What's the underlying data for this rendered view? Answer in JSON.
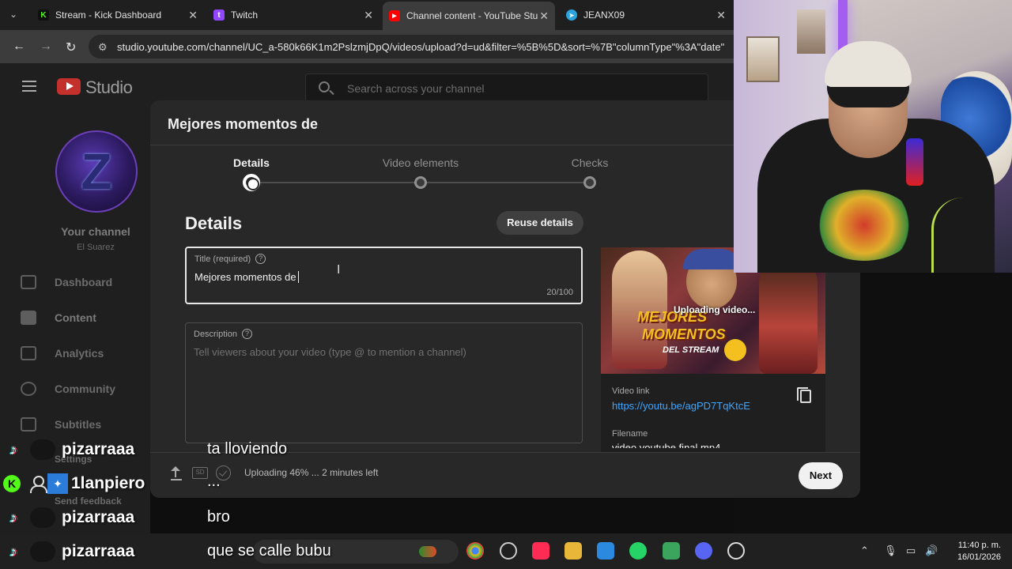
{
  "browser": {
    "tabs": [
      {
        "title": "Stream - Kick Dashboard",
        "favicon": "K"
      },
      {
        "title": "Twitch",
        "favicon": "twitch-icon"
      },
      {
        "title": "Channel content - YouTube Stu",
        "favicon": "youtube-icon"
      },
      {
        "title": "JEANX09",
        "favicon": "telegram-icon"
      }
    ],
    "url": "studio.youtube.com/channel/UC_a-580k66K1m2PslzmjDpQ/videos/upload?d=ud&filter=%5B%5D&sort=%7B\"columnType\"%3A\"date\""
  },
  "studio": {
    "logo_text": "Studio",
    "search_placeholder": "Search across your channel",
    "channel_label": "Your channel",
    "channel_name": "El Suarez",
    "nav": [
      {
        "label": "Dashboard"
      },
      {
        "label": "Content"
      },
      {
        "label": "Analytics"
      },
      {
        "label": "Community"
      },
      {
        "label": "Subtitles"
      }
    ]
  },
  "dialog": {
    "title": "Mejores momentos de",
    "steps": [
      {
        "label": "Details",
        "active": true
      },
      {
        "label": "Video elements",
        "active": false
      },
      {
        "label": "Checks",
        "active": false
      }
    ],
    "section_heading": "Details",
    "reuse_button": "Reuse details",
    "title_field": {
      "label": "Title (required)",
      "value": "Mejores momentos de",
      "counter": "20/100"
    },
    "description_field": {
      "label": "Description",
      "placeholder": "Tell viewers about your video (type @ to mention a channel)"
    },
    "preview": {
      "thumb_line1": "MEJORES",
      "thumb_line2": "MOMENTOS",
      "thumb_line3": "DEL STREAM",
      "overlay_status": "Uploading video...",
      "video_link_label": "Video link",
      "video_link": "https://youtu.be/agPD7TqKtcE",
      "filename_label": "Filename",
      "filename": "video youtube final mp4"
    },
    "footer": {
      "status": "Uploading 46% ... 2 minutes left",
      "progress_percent": 46,
      "next_button": "Next",
      "sd_badge": "SD"
    }
  },
  "chat": [
    {
      "platform": "tiktok",
      "user": "pizarraaa",
      "message": "ta lloviendo"
    },
    {
      "platform": "kick",
      "user": "1lanpiero",
      "message": "..."
    },
    {
      "platform": "tiktok",
      "user": "pizarraaa",
      "message": "bro"
    },
    {
      "platform": "tiktok",
      "user": "pizarraaa",
      "message": "que se calle bubu"
    }
  ],
  "hidden_nav": {
    "settings": "Settings",
    "feedback": "Send feedback"
  },
  "taskbar": {
    "time": "11:40 p. m.",
    "date": "16/01/2026"
  },
  "colors": {
    "youtube_red": "#c4302b",
    "link_blue": "#3ea6ff",
    "kick_green": "#53fc18",
    "neon_purple": "#a35ef0"
  }
}
